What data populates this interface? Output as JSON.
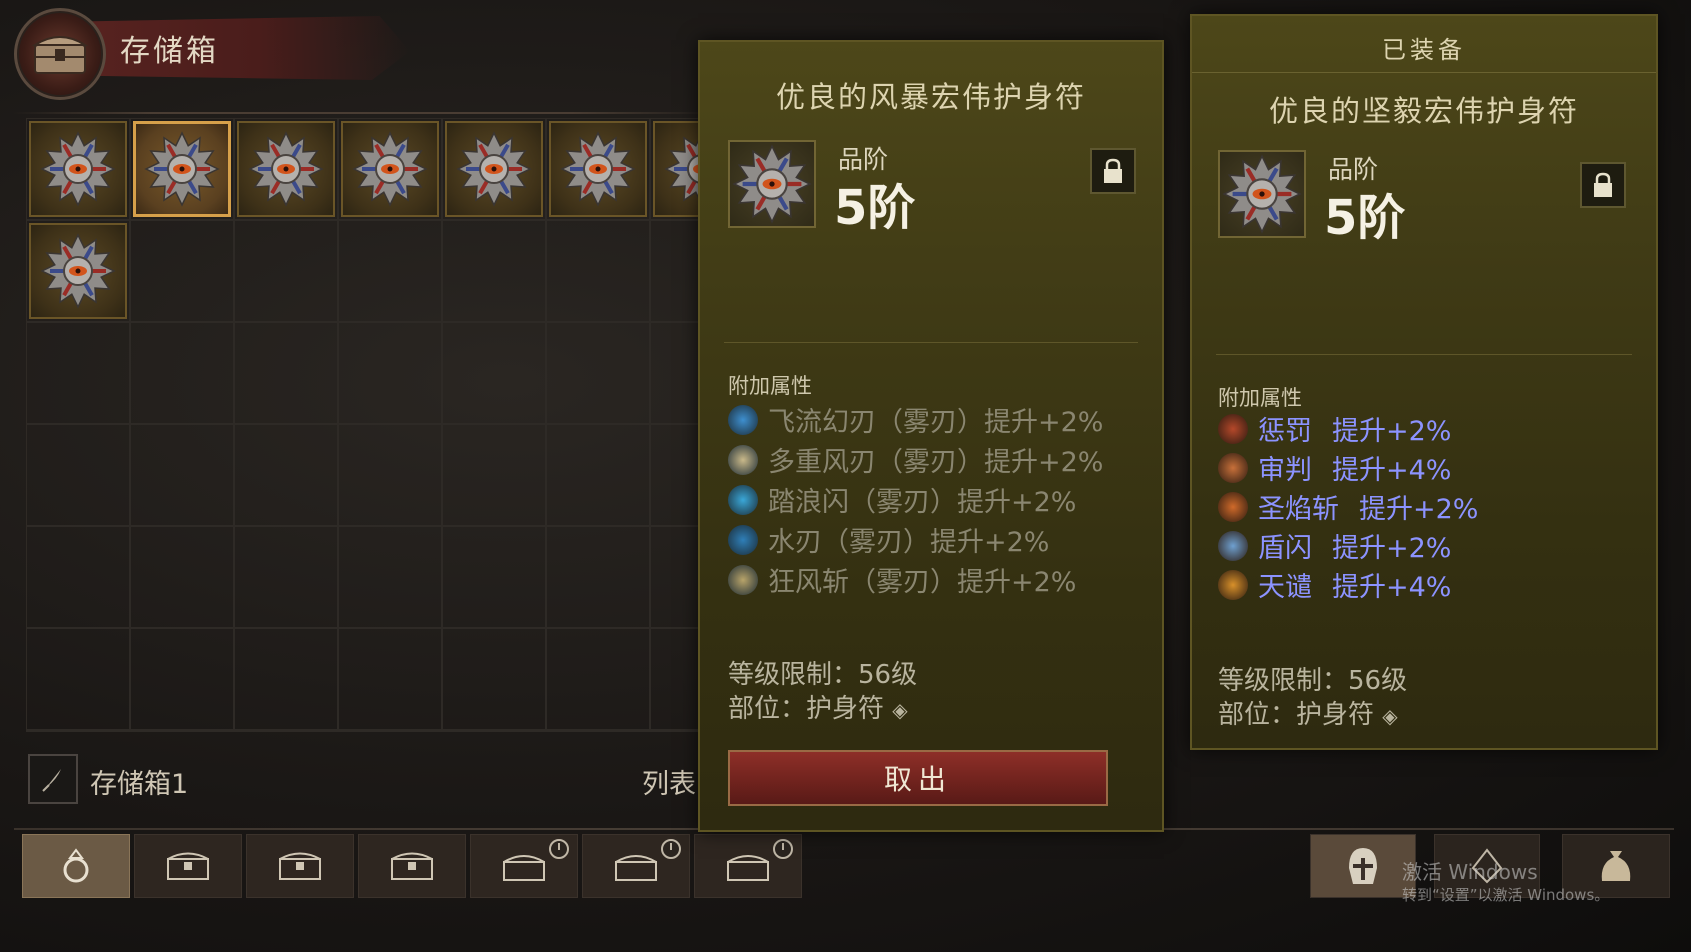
{
  "header": {
    "title": "存储箱"
  },
  "stash": {
    "name": "存储箱1",
    "list_label": "列表"
  },
  "tooltip_item": {
    "title": "优良的风暴宏伟护身符",
    "grade_label": "品阶",
    "grade_value": "5阶",
    "section_label": "附加属性",
    "attributes": [
      {
        "text": "飞流幻刃（雾刃）提升+2%",
        "icon": "blue-swirl-icon"
      },
      {
        "text": "多重风刃（雾刃）提升+2%",
        "icon": "crescent-blade-icon"
      },
      {
        "text": "踏浪闪（雾刃）提升+2%",
        "icon": "water-dash-icon"
      },
      {
        "text": "水刃（雾刃）提升+2%",
        "icon": "water-blade-icon"
      },
      {
        "text": "狂风斩（雾刃）提升+2%",
        "icon": "gale-slash-icon"
      }
    ],
    "level_req": "等级限制：56级",
    "slot": "部位：护身符",
    "take_out": "取出"
  },
  "tooltip_equipped": {
    "equipped_label": "已装备",
    "title": "优良的坚毅宏伟护身符",
    "grade_label": "品阶",
    "grade_value": "5阶",
    "section_label": "附加属性",
    "attributes": [
      {
        "name": "惩罚",
        "bonus": "提升+2%",
        "icon": "punish-icon"
      },
      {
        "name": "审判",
        "bonus": "提升+4%",
        "icon": "judgment-icon"
      },
      {
        "name": "圣焰斩",
        "bonus": "提升+2%",
        "icon": "holy-flame-icon"
      },
      {
        "name": "盾闪",
        "bonus": "提升+2%",
        "icon": "shield-flash-icon"
      },
      {
        "name": "天谴",
        "bonus": "提升+4%",
        "icon": "wrath-icon"
      }
    ],
    "level_req": "等级限制：56级",
    "slot": "部位：护身符"
  },
  "watermark": {
    "line1": "激活 Windows",
    "line2": "转到“设置”以激活 Windows。"
  },
  "colors": {
    "attr_grey": "#8a8670",
    "attr_blue": "#8c93ff",
    "gold_frame": "#d6a04a"
  }
}
